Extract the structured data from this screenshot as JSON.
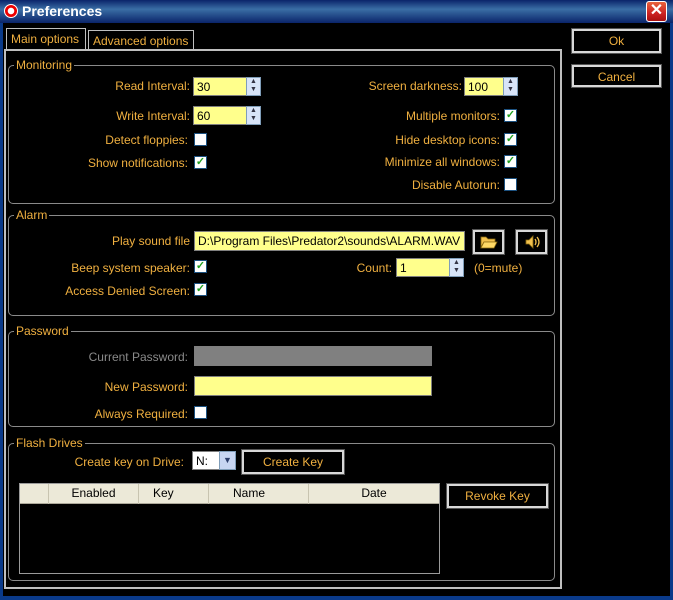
{
  "window": {
    "title": "Preferences",
    "close_glyph": "✕"
  },
  "tabs": [
    "Main options",
    "Advanced options"
  ],
  "buttons": {
    "ok": "Ok",
    "cancel": "Cancel",
    "create_key": "Create Key",
    "revoke_key": "Revoke Key"
  },
  "monitoring": {
    "legend": "Monitoring",
    "read_interval_label": "Read Interval:",
    "read_interval_value": "30",
    "write_interval_label": "Write Interval:",
    "write_interval_value": "60",
    "detect_floppies_label": "Detect floppies:",
    "detect_floppies": false,
    "show_notifications_label": "Show notifications:",
    "show_notifications": true,
    "screen_darkness_label": "Screen darkness:",
    "screen_darkness_value": "100",
    "multiple_monitors_label": "Multiple monitors:",
    "multiple_monitors": true,
    "hide_desktop_icons_label": "Hide desktop icons:",
    "hide_desktop_icons": true,
    "minimize_all_label": "Minimize all windows:",
    "minimize_all": true,
    "disable_autorun_label": "Disable Autorun:",
    "disable_autorun": false
  },
  "alarm": {
    "legend": "Alarm",
    "play_sound_label": "Play sound file",
    "sound_file": "D:\\Program Files\\Predator2\\sounds\\ALARM.WAV",
    "beep_label": "Beep system speaker:",
    "beep": true,
    "access_denied_label": "Access Denied Screen:",
    "access_denied": true,
    "count_label": "Count:",
    "count_value": "1",
    "count_hint": "(0=mute)"
  },
  "password": {
    "legend": "Password",
    "current_label": "Current Password:",
    "current_value": "",
    "new_label": "New Password:",
    "new_value": "",
    "always_required_label": "Always Required:",
    "always_required": false
  },
  "flash_drives": {
    "legend": "Flash Drives",
    "create_key_label": "Create key on Drive:",
    "drive_value": "N:",
    "columns": [
      "",
      "Enabled",
      "Key",
      "Name",
      "Date"
    ]
  },
  "icons": {
    "folder": "folder-open-icon",
    "speaker": "speaker-icon",
    "check": "✓"
  }
}
